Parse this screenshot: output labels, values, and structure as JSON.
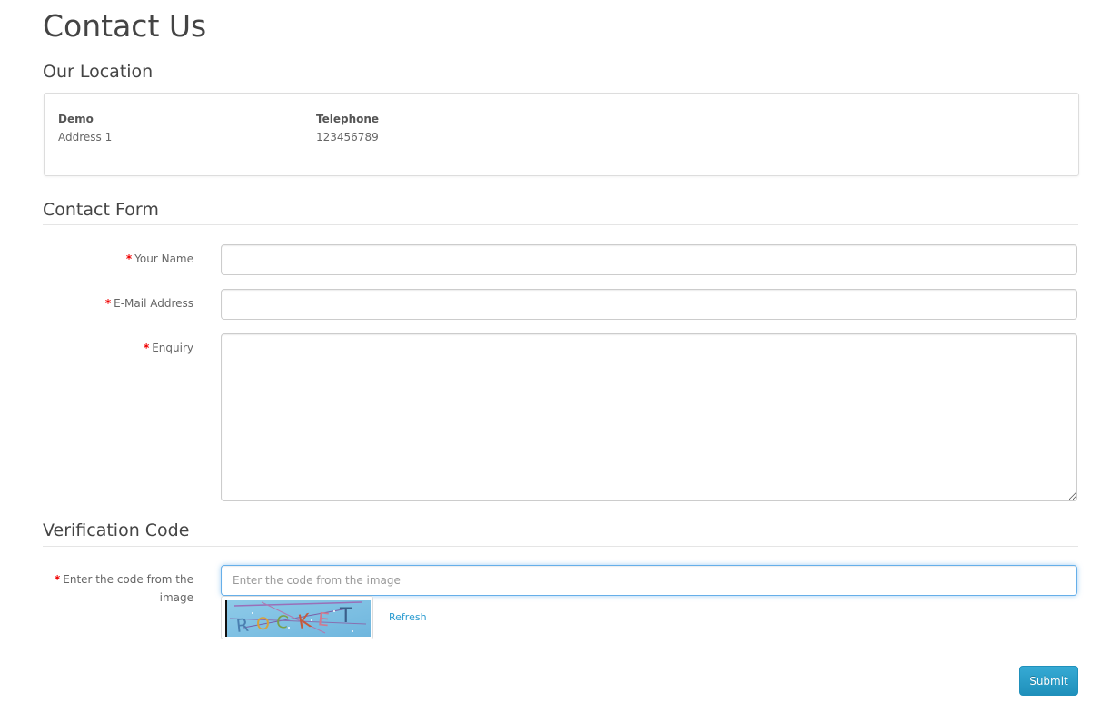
{
  "page": {
    "title": "Contact Us"
  },
  "location": {
    "heading": "Our Location",
    "store_name": "Demo",
    "address": "Address 1",
    "telephone_label": "Telephone",
    "telephone": "123456789"
  },
  "contact_form": {
    "heading": "Contact Form",
    "name_label": "Your Name",
    "name_value": "",
    "email_label": "E-Mail Address",
    "email_value": "",
    "enquiry_label": "Enquiry",
    "enquiry_value": "",
    "required_marker": "*"
  },
  "verification": {
    "heading": "Verification Code",
    "code_label": "Enter the code from the image",
    "code_placeholder": "Enter the code from the image",
    "captcha_text": "ROCKET",
    "refresh_label": "Refresh"
  },
  "actions": {
    "submit_label": "Submit"
  },
  "colors": {
    "required": "#f00000",
    "link": "#2a9bd0",
    "button": "#2a9fcb",
    "focus_border": "#66afe9"
  }
}
